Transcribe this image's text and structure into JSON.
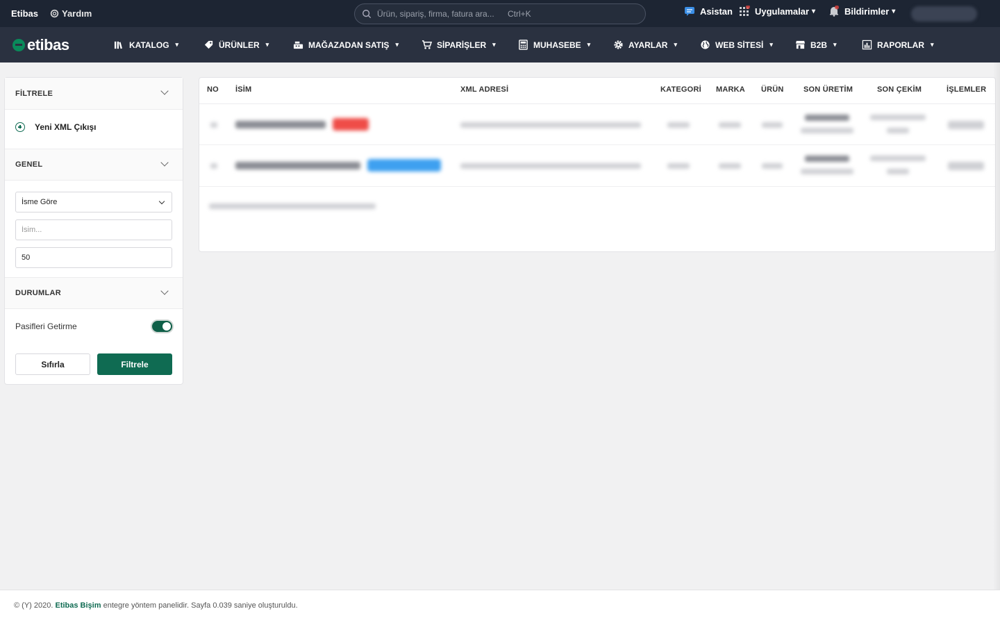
{
  "topbar": {
    "brand": "Etibas",
    "help_label": "Yardım",
    "search_placeholder": "Ürün, sipariş, firma, fatura ara...",
    "search_shortcut": "Ctrl+K",
    "asistan_label": "Asistan",
    "apps_label": "Uygulamalar",
    "notifications_label": "Bildirimler"
  },
  "nav": {
    "logo": "etibas",
    "items": [
      {
        "label": "KATALOG",
        "icon": "books-icon"
      },
      {
        "label": "ÜRÜNLER",
        "icon": "tag-icon"
      },
      {
        "label": "MAĞAZADAN SATIŞ",
        "icon": "cash-register-icon"
      },
      {
        "label": "SİPARİŞLER",
        "icon": "cart-icon"
      },
      {
        "label": "MUHASEBE",
        "icon": "calculator-icon"
      },
      {
        "label": "AYARLAR",
        "icon": "gear-icon"
      },
      {
        "label": "WEB SİTESİ",
        "icon": "globe-icon"
      },
      {
        "label": "B2B",
        "icon": "store-icon"
      },
      {
        "label": "RAPORLAR",
        "icon": "chart-icon"
      }
    ]
  },
  "sidebar": {
    "filter_title": "FİLTRELE",
    "new_xml_label": "Yeni XML Çıkışı",
    "general_title": "GENEL",
    "sort_value": "İsme Göre",
    "name_placeholder": "İsim...",
    "limit_value": "50",
    "statuses_title": "DURUMLAR",
    "toggle_label": "Pasifleri Getirme",
    "reset_label": "Sıfırla",
    "filter_label": "Filtrele"
  },
  "table": {
    "headers": {
      "no": "NO",
      "name": "İSİM",
      "xml": "XML ADRESİ",
      "category": "KATEGORİ",
      "brand": "MARKA",
      "product": "ÜRÜN",
      "last_gen": "SON ÜRETİM",
      "last_fetch": "SON ÇEKİM",
      "actions": "İŞLEMLER"
    }
  },
  "footer": {
    "prefix": "© (Y) 2020.",
    "link": "Etibas Bişim",
    "suffix": "entegre yöntem panelidir. Sayfa 0.039 saniye oluşturuldu."
  }
}
